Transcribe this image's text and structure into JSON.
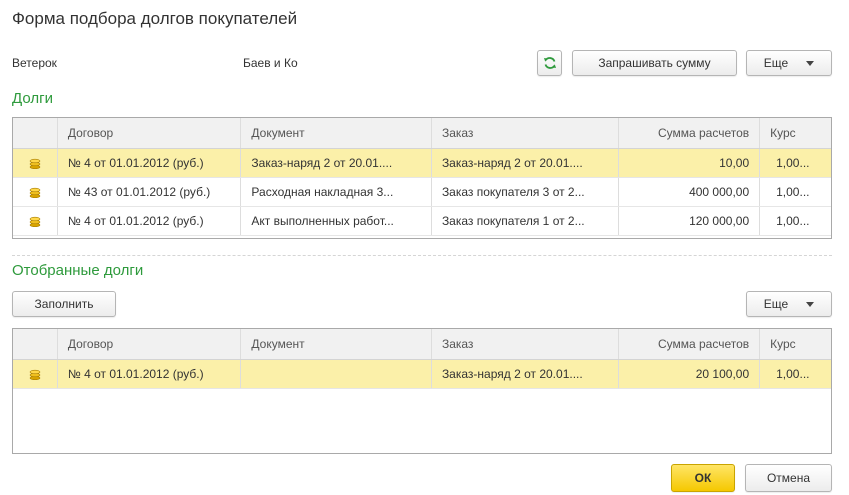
{
  "title": "Форма подбора долгов покупателей",
  "header": {
    "organization": "Ветерок",
    "counterparty": "Баев и Ко"
  },
  "toolbar": {
    "ask_amount_label": "Запрашивать сумму",
    "more_label": "Еще"
  },
  "debts": {
    "heading": "Долги",
    "columns": [
      "Договор",
      "Документ",
      "Заказ",
      "Сумма расчетов",
      "Курс"
    ],
    "rows": [
      {
        "contract": "№ 4 от 01.01.2012 (руб.)",
        "document": "Заказ-наряд 2 от 20.01....",
        "order": "Заказ-наряд 2 от 20.01....",
        "amount": "10,00",
        "rate": "1,00..."
      },
      {
        "contract": "№ 43 от 01.01.2012 (руб.)",
        "document": "Расходная накладная 3...",
        "order": "Заказ покупателя 3 от 2...",
        "amount": "400 000,00",
        "rate": "1,00..."
      },
      {
        "contract": "№ 4 от 01.01.2012 (руб.)",
        "document": "Акт выполненных работ...",
        "order": "Заказ покупателя 1 от 2...",
        "amount": "120 000,00",
        "rate": "1,00..."
      }
    ]
  },
  "selected": {
    "heading": "Отобранные долги",
    "fill_label": "Заполнить",
    "more_label": "Еще",
    "columns": [
      "Договор",
      "Документ",
      "Заказ",
      "Сумма расчетов",
      "Курс"
    ],
    "rows": [
      {
        "contract": "№ 4 от 01.01.2012 (руб.)",
        "document": "",
        "order": "Заказ-наряд 2 от 20.01....",
        "amount": "20 100,00",
        "rate": "1,00..."
      }
    ]
  },
  "footer": {
    "ok_label": "ОК",
    "cancel_label": "Отмена"
  },
  "colors": {
    "accent_green": "#2e9a3c",
    "selection": "#fbf0a9",
    "ok_button": "#f5c800"
  },
  "icons": {
    "refresh": "refresh-icon",
    "row": "coins-icon",
    "dropdown": "chevron-down-icon"
  }
}
